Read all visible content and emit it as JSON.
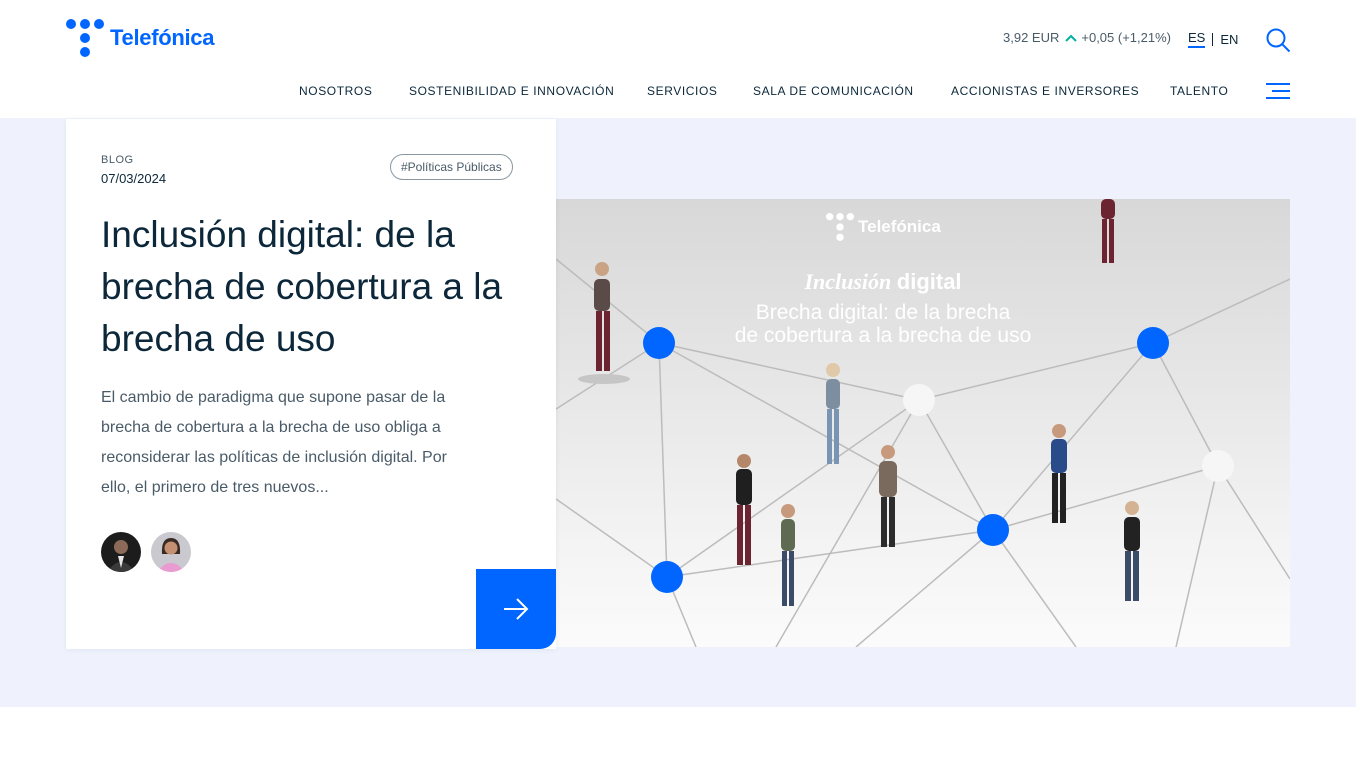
{
  "brand": {
    "name": "Telefónica",
    "accent": "#0066ff"
  },
  "stock": {
    "price": "3,92 EUR",
    "change": "+0,05 (+1,21%)",
    "trend": "up",
    "trend_color": "#00b0a0"
  },
  "languages": {
    "es": "ES",
    "en": "EN",
    "active": "ES"
  },
  "nav": {
    "items": [
      "NOSOTROS",
      "SOSTENIBILIDAD E INNOVACIÓN",
      "SERVICIOS",
      "SALA DE COMUNICACIÓN",
      "ACCIONISTAS E INVERSORES",
      "TALENTO"
    ]
  },
  "article": {
    "kicker": "BLOG",
    "date": "07/03/2024",
    "tag": "#Políticas Públicas",
    "title": "Inclusión digital: de la brecha de cobertura a la brecha de uso",
    "excerpt": "El cambio de paradigma que supone pasar de la brecha de cobertura a la brecha de uso obliga a reconsiderar las políticas de inclusión digital. Por ello, el primero de tres nuevos..."
  },
  "hero_image": {
    "brand": "Telefónica",
    "head_italic": "Inclusión",
    "head_regular": "digital",
    "subtitle_line1": "Brecha digital: de la brecha",
    "subtitle_line2": "de cobertura a la brecha de uso"
  },
  "icons": {
    "search": "search-icon",
    "menu": "hamburger-menu-icon",
    "cta": "arrow-right-icon",
    "stock_trend": "chevron-up-icon"
  }
}
